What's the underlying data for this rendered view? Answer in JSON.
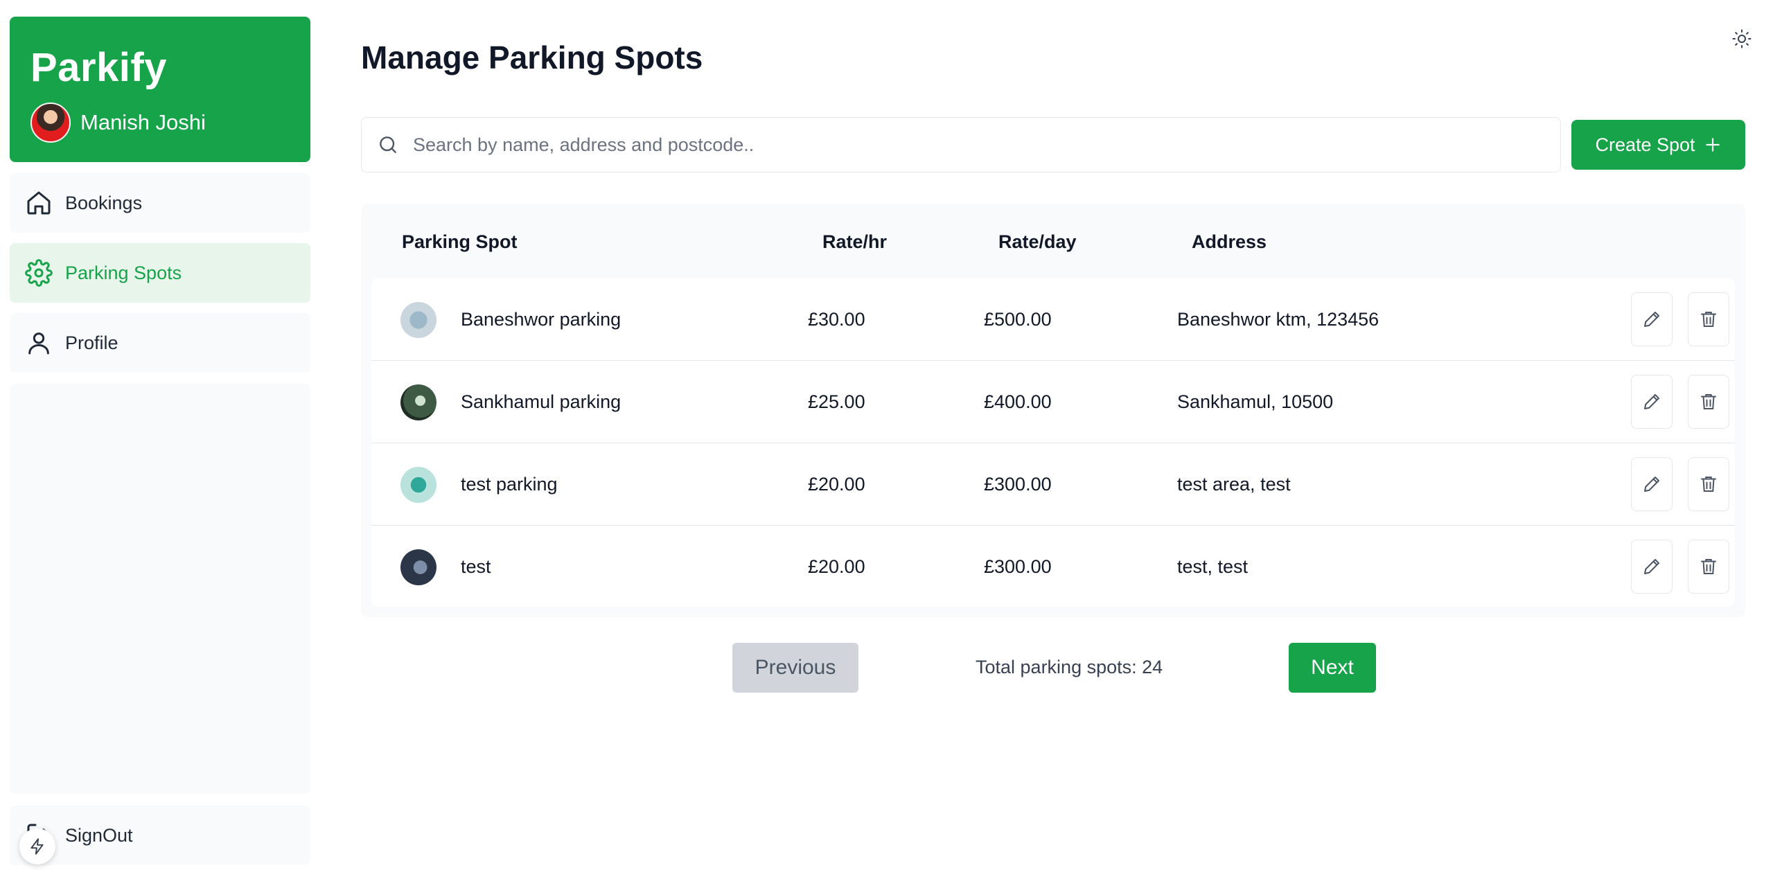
{
  "brand": {
    "title": "Parkify",
    "user_name": "Manish Joshi"
  },
  "sidebar": {
    "items": [
      {
        "label": "Bookings",
        "icon": "home-icon",
        "active": false
      },
      {
        "label": "Parking Spots",
        "icon": "gear-icon",
        "active": true
      },
      {
        "label": "Profile",
        "icon": "user-icon",
        "active": false
      }
    ],
    "signout_label": "SignOut"
  },
  "page": {
    "title": "Manage Parking Spots"
  },
  "search": {
    "placeholder": "Search by name, address and postcode.."
  },
  "create_button": {
    "label": "Create Spot",
    "icon": "plus-icon"
  },
  "table": {
    "headers": [
      "Parking Spot",
      "Rate/hr",
      "Rate/day",
      "Address"
    ],
    "rows": [
      {
        "name": "Baneshwor parking",
        "rate_hr": "£30.00",
        "rate_day": "£500.00",
        "address": "Baneshwor ktm, 123456"
      },
      {
        "name": "Sankhamul parking",
        "rate_hr": "£25.00",
        "rate_day": "£400.00",
        "address": "Sankhamul, 10500"
      },
      {
        "name": "test parking",
        "rate_hr": "£20.00",
        "rate_day": "£300.00",
        "address": "test area, test"
      },
      {
        "name": "test",
        "rate_hr": "£20.00",
        "rate_day": "£300.00",
        "address": "test, test"
      }
    ]
  },
  "pagination": {
    "previous_label": "Previous",
    "total_text": "Total parking spots: 24",
    "next_label": "Next"
  },
  "colors": {
    "accent": "#16a34a",
    "active_bg": "#e7f5eb",
    "panel_bg": "#f9fafb"
  }
}
